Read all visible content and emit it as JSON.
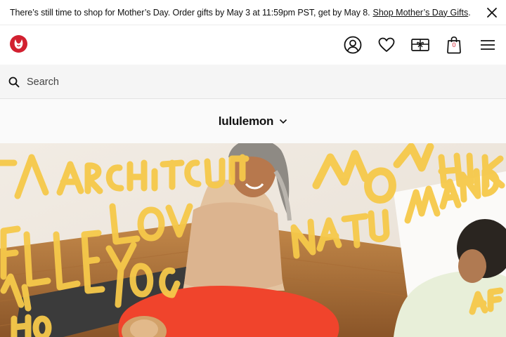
{
  "promo": {
    "text": "There’s still time to shop for Mother’s Day. Order gifts by May 3 at 11:59pm PST, get by May 8.",
    "link": "Shop Mother’s Day Gifts",
    "trailing": "."
  },
  "header": {
    "logo_icon": "lululemon-logo-icon",
    "icons": [
      "account-icon",
      "wishlist-heart-icon",
      "gift-card-icon",
      "shopping-bag-icon",
      "menu-icon"
    ],
    "bag_count": "0",
    "brand_color": "#d22030"
  },
  "search": {
    "placeholder": "Search",
    "value": ""
  },
  "brand_selector": {
    "label": "lululemon"
  },
  "hero": {
    "words": [
      "ARCHITECTURE",
      "LOVER",
      "YOGI",
      "MOM",
      "HIKER",
      "NATURE",
      "WANDERER",
      "ALL",
      "HOUSE",
      "AFIC"
    ]
  }
}
